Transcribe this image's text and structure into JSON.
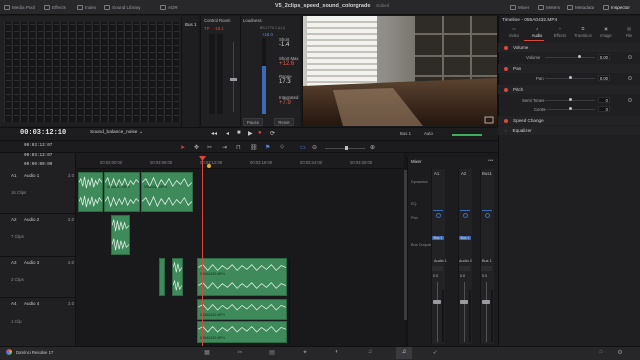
{
  "topbar": {
    "media_pool": "Media Pool",
    "effects": "Effects",
    "index": "Index",
    "sound_library": "Sound Library",
    "adr": "ADR",
    "project_title": "V5_2clips_speed_sound_colorgrade",
    "edited": "Edited",
    "mixer": "Mixer",
    "meters": "Meters",
    "metadata": "Metadata",
    "inspector": "Inspector"
  },
  "meters_panel": {
    "bus1_label": "Bus 1"
  },
  "control_room": {
    "title": "Control Room",
    "tp_label": "TP",
    "tp_value": "-19.1",
    "dim": "DIM",
    "mute": "MUTE"
  },
  "loudness": {
    "title": "Loudness",
    "standard": "BS.1770-1 (LU)",
    "ref": "+18.0",
    "short_label": "Short",
    "short_value": "-1.4",
    "short_max_label": "Short Max",
    "short_max_value": "+12.6",
    "range_label": "Range",
    "range_value": "17.3",
    "integrated_label": "Integrated",
    "integrated_value": "+7.9",
    "pause": "Pause",
    "reset": "Reset"
  },
  "inspector": {
    "timeline_clip": "Timeline - 055A0432.MP4",
    "tabs": [
      "Video",
      "Audio",
      "Effects",
      "Transition",
      "Image",
      "File"
    ],
    "active_tab": "Audio",
    "volume_section": "Volume",
    "volume_label": "Volume",
    "volume_value": "0.00",
    "pan_section": "Pan",
    "pan_label": "Pan",
    "pan_value": "0.00",
    "pitch_section": "Pitch",
    "semitones_label": "Semi Tones",
    "semitones_value": "0",
    "cents_label": "Cents",
    "cents_value": "0",
    "speed_change": "Speed Change",
    "equalizer": "Equalizer"
  },
  "transport": {
    "timecode": "00:03:12:10",
    "timeline_name": "Sound_balance_noise",
    "bus_label": "Bus 1",
    "auto_label": "Auto"
  },
  "timeline_header": {
    "tc1": "00:03:13:07",
    "tc2": "00:03:13:07",
    "tc3": "00:00:00:00"
  },
  "ruler": [
    "00:03:00:00",
    "00:03:06:00",
    "00:03:12:00",
    "00:03:18:00",
    "00:03:24:00",
    "00:03:30:00"
  ],
  "tracks": [
    {
      "code": "A1",
      "name": "Audio 1",
      "value": "2.0",
      "clips": "16 Clips"
    },
    {
      "code": "A2",
      "name": "Audio 2",
      "value": "2.0",
      "clips": "7 Clips"
    },
    {
      "code": "A3",
      "name": "Audio 3",
      "value": "2.0",
      "clips": "3 Clips"
    },
    {
      "code": "A4",
      "name": "Audio 4",
      "value": "2.0",
      "clips": "1 Clip"
    }
  ],
  "clip_labels": {
    "c1": "055A04...MP4",
    "c2": "055A04...MP4",
    "c3": "055A0432.MP4",
    "c4": "055A0432.MP4",
    "c5": "055A0432.MP4",
    "c6": "055A0432.MP4"
  },
  "mixer": {
    "title": "Mixer",
    "strips": [
      "A1",
      "A2",
      "Bus1"
    ],
    "dynamics": "Dynamics",
    "eq": "EQ",
    "pan": "Pan",
    "bus_outputs": "Bus Outputs",
    "bus1_tag": "Bus 1",
    "strip_names": [
      "Audio 1",
      "Audio 2",
      "Bus 1"
    ],
    "fader_values": [
      "0.0",
      "0.0",
      "0.0"
    ]
  },
  "bottombar": {
    "app_name": "DaVinci Resolve 17"
  }
}
